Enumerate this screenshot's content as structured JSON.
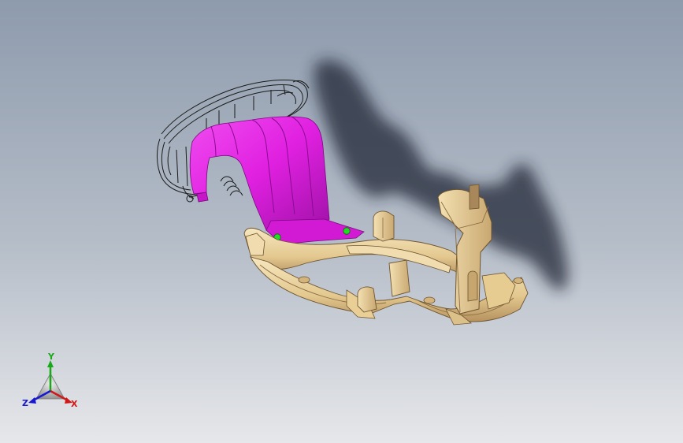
{
  "viewport": {
    "background_top": "#8f9cad",
    "background_bottom": "#e4e6e9"
  },
  "model": {
    "wireframe_color": "#1a1a1a",
    "highlight_color": "#e020e0",
    "highlight_shade": "#a010a8",
    "body_color": "#e8cf9a",
    "body_shade": "#a8875a",
    "body_light": "#f6e6bf",
    "marker_color": "#22dd22",
    "shadow_color": "#1e2430"
  },
  "triad": {
    "axis_y": "Y",
    "axis_x": "X",
    "axis_z": "Z",
    "y_color": "#18a818",
    "x_color": "#d01818",
    "z_color": "#1818d0"
  }
}
